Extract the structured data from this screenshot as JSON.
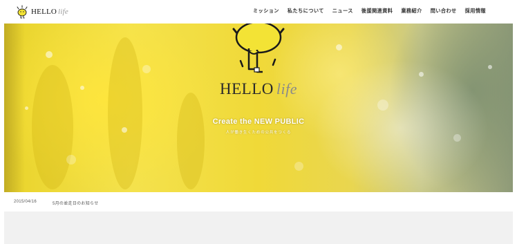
{
  "header": {
    "logo_text": "HELLO",
    "logo_life": "life",
    "nav": [
      "ミッション",
      "私たちについて",
      "ニュース",
      "後援関連資料",
      "業務紹介",
      "問い合わせ",
      "採用情報"
    ]
  },
  "hero": {
    "logo_text": "HELLO",
    "logo_life": "life",
    "tagline": "Create the NEW PUBLIC",
    "subtagline": "人が働き生くための公共をつくる"
  },
  "news": {
    "date": "2015/04/16",
    "title": "5月の並走日のお知らせ"
  },
  "colors": {
    "hero_yellow": "#f0d938",
    "mascot_yellow": "#f3e335",
    "text_dark": "#222222"
  },
  "icons": {
    "logo": "mascot-icon"
  }
}
